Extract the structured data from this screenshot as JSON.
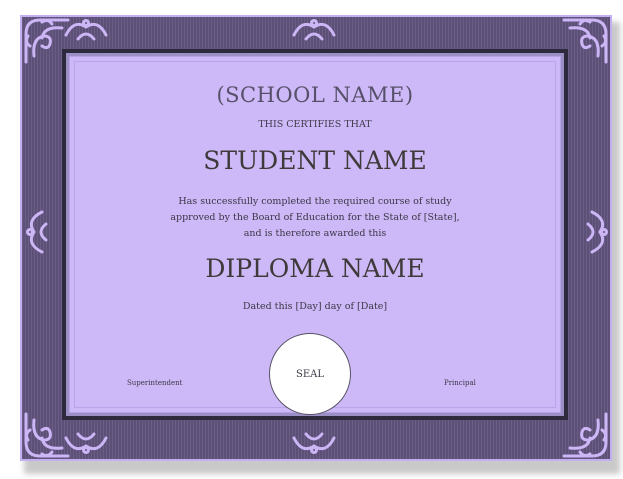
{
  "certificate": {
    "school_name": "(SCHOOL NAME)",
    "certifies_line": "THIS CERTIFIES THAT",
    "student_name": "STUDENT NAME",
    "body_line_1": "Has successfully completed the required course of study",
    "body_line_2": "approved by the Board of Education for the State of [State],",
    "body_line_3": "and is therefore awarded this",
    "diploma_name": "DIPLOMA NAME",
    "dated_line": "Dated this [Day] day of [Date]",
    "seal_label": "SEAL",
    "left_signature": "Superintendent",
    "right_signature": "Principal"
  },
  "colors": {
    "frame": "#5f5379",
    "panel": "#cdb9f7",
    "ornament": "#c9b3f3",
    "text": "#3e3a3a"
  },
  "icons": {
    "corner": "scroll-ornament-icon",
    "edge": "flourish-ornament-icon"
  }
}
